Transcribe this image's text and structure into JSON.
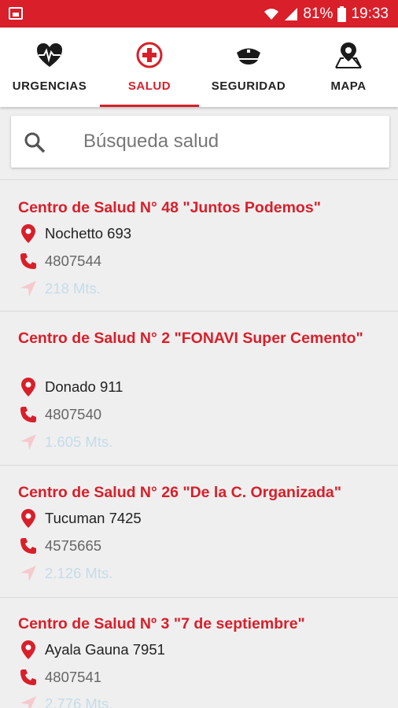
{
  "status_bar": {
    "battery": "81%",
    "time": "19:33"
  },
  "tabs": [
    {
      "label": "URGENCIAS",
      "icon": "heart-pulse-icon",
      "active": false
    },
    {
      "label": "SALUD",
      "icon": "medical-cross-icon",
      "active": true
    },
    {
      "label": "SEGURIDAD",
      "icon": "police-cap-icon",
      "active": false
    },
    {
      "label": "MAPA",
      "icon": "map-pin-icon",
      "active": false
    }
  ],
  "search": {
    "placeholder": "Búsqueda salud"
  },
  "centers": [
    {
      "name": "Centro de Salud N° 48 \"Juntos Podemos\"",
      "address": "Nochetto 693",
      "phone": "4807544",
      "distance": "218 Mts."
    },
    {
      "name": "Centro de Salud N° 2 \"FONAVI Super Cemento\"",
      "address": "Donado 911",
      "phone": "4807540",
      "distance": "1.605 Mts."
    },
    {
      "name": "Centro de Salud N° 26 \"De la C. Organizada\"",
      "address": "Tucuman 7425",
      "phone": "4575665",
      "distance": "2.126 Mts."
    },
    {
      "name": "Centro de Salud Nº 3 \"7 de septiembre\"",
      "address": "Ayala Gauna 7951",
      "phone": "4807541",
      "distance": "2.776 Mts."
    }
  ],
  "colors": {
    "accent": "#d81f2a",
    "distance_text": "#c5dcea"
  }
}
